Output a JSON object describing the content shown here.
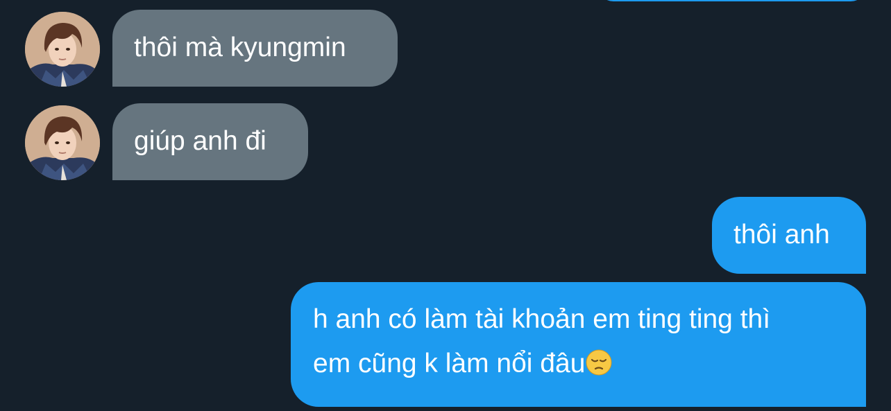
{
  "conversation": {
    "messages": [
      {
        "sender": "other",
        "text": "thôi mà kyungmin"
      },
      {
        "sender": "other",
        "text": "giúp anh đi"
      },
      {
        "sender": "self",
        "text": "thôi anh"
      },
      {
        "sender": "self",
        "line1": "h anh có làm tài khoản em ting ting thì",
        "line2": "em cũng k làm nổi đâu",
        "emoji": "pensive-face-icon"
      }
    ]
  },
  "colors": {
    "background": "#15202b",
    "incoming_bubble": "#66757f",
    "outgoing_bubble": "#1d9bf0",
    "text": "#ffffff"
  }
}
